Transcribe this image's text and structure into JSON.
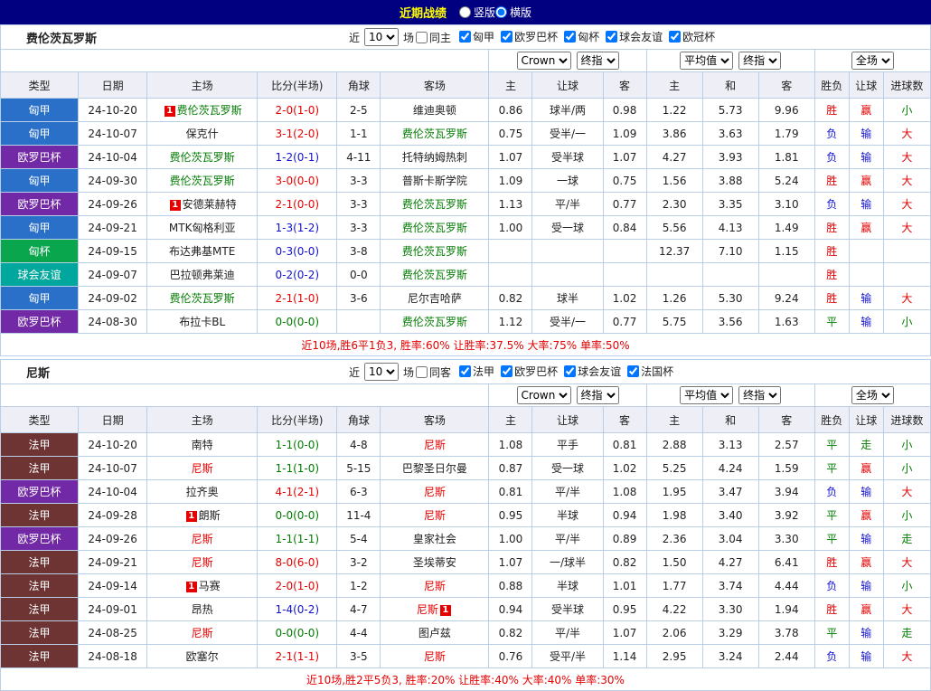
{
  "palette": {
    "red": "#e60000",
    "blue": "#1010d0",
    "green": "#007b00",
    "black": "#222222",
    "topbar_bg": "#000080",
    "title_color": "#ffff00",
    "border": "#b9cfe7",
    "header_bg": "#eeeef6",
    "league": {
      "匈甲": "#2a70c8",
      "欧罗巴杯": "#7229a5",
      "匈杯": "#0aa64e",
      "球会友谊": "#00a79c",
      "法甲": "#6e3434"
    }
  },
  "topbar": {
    "title": "近期战绩",
    "layout_options": [
      {
        "label": "竖版",
        "selected": false
      },
      {
        "label": "横版",
        "selected": true
      }
    ]
  },
  "table_columns": [
    "类型",
    "日期",
    "主场",
    "比分(半场)",
    "角球",
    "客场",
    "主",
    "让球",
    "客",
    "主",
    "和",
    "客",
    "胜负",
    "让球",
    "进球数"
  ],
  "sections": [
    {
      "team": "费伦茨瓦罗斯",
      "filter": {
        "prefix": "近",
        "count": "10",
        "suffix": "场",
        "same": {
          "label": "同主",
          "checked": false
        },
        "leagues": [
          {
            "label": "匈甲",
            "checked": true
          },
          {
            "label": "欧罗巴杯",
            "checked": true
          },
          {
            "label": "匈杯",
            "checked": true
          },
          {
            "label": "球会友谊",
            "checked": true
          },
          {
            "label": "欧冠杯",
            "checked": true
          }
        ]
      },
      "selects": {
        "odds_source": "Crown",
        "odds_kind": "终指",
        "euro_source": "平均值",
        "euro_kind": "终指",
        "scope": "全场"
      },
      "rows": [
        {
          "league": "匈甲",
          "date": "24-10-20",
          "home": "费伦茨瓦罗斯",
          "home_color": "green",
          "home_card": "1",
          "score": "2-0(1-0)",
          "score_color": "red",
          "corners": "2-5",
          "away": "维迪奥顿",
          "away_color": "",
          "away_card": "",
          "ah": [
            "0.86",
            "球半/两",
            "0.98"
          ],
          "eu": [
            "1.22",
            "5.73",
            "9.96"
          ],
          "res": [
            "胜",
            "赢",
            "小"
          ],
          "res_colors": [
            "red",
            "red",
            "green"
          ]
        },
        {
          "league": "匈甲",
          "date": "24-10-07",
          "home": "保克什",
          "home_color": "",
          "home_card": "",
          "score": "3-1(2-0)",
          "score_color": "red",
          "corners": "1-1",
          "away": "费伦茨瓦罗斯",
          "away_color": "green",
          "away_card": "",
          "ah": [
            "0.75",
            "受半/一",
            "1.09"
          ],
          "eu": [
            "3.86",
            "3.63",
            "1.79"
          ],
          "res": [
            "负",
            "输",
            "大"
          ],
          "res_colors": [
            "blue",
            "blue",
            "red"
          ]
        },
        {
          "league": "欧罗巴杯",
          "date": "24-10-04",
          "home": "费伦茨瓦罗斯",
          "home_color": "green",
          "home_card": "",
          "score": "1-2(0-1)",
          "score_color": "blue",
          "corners": "4-11",
          "away": "托特纳姆热刺",
          "away_color": "",
          "away_card": "",
          "ah": [
            "1.07",
            "受半球",
            "1.07"
          ],
          "eu": [
            "4.27",
            "3.93",
            "1.81"
          ],
          "res": [
            "负",
            "输",
            "大"
          ],
          "res_colors": [
            "blue",
            "blue",
            "red"
          ]
        },
        {
          "league": "匈甲",
          "date": "24-09-30",
          "home": "费伦茨瓦罗斯",
          "home_color": "green",
          "home_card": "",
          "score": "3-0(0-0)",
          "score_color": "red",
          "corners": "3-3",
          "away": "普斯卡斯学院",
          "away_color": "",
          "away_card": "",
          "ah": [
            "1.09",
            "一球",
            "0.75"
          ],
          "eu": [
            "1.56",
            "3.88",
            "5.24"
          ],
          "res": [
            "胜",
            "赢",
            "大"
          ],
          "res_colors": [
            "red",
            "red",
            "red"
          ]
        },
        {
          "league": "欧罗巴杯",
          "date": "24-09-26",
          "home": "安德莱赫特",
          "home_color": "",
          "home_card": "1",
          "score": "2-1(0-0)",
          "score_color": "red",
          "corners": "3-3",
          "away": "费伦茨瓦罗斯",
          "away_color": "green",
          "away_card": "",
          "ah": [
            "1.13",
            "平/半",
            "0.77"
          ],
          "eu": [
            "2.30",
            "3.35",
            "3.10"
          ],
          "res": [
            "负",
            "输",
            "大"
          ],
          "res_colors": [
            "blue",
            "blue",
            "red"
          ]
        },
        {
          "league": "匈甲",
          "date": "24-09-21",
          "home": "MTK匈格利亚",
          "home_color": "",
          "home_card": "",
          "score": "1-3(1-2)",
          "score_color": "blue",
          "corners": "3-3",
          "away": "费伦茨瓦罗斯",
          "away_color": "green",
          "away_card": "",
          "ah": [
            "1.00",
            "受一球",
            "0.84"
          ],
          "eu": [
            "5.56",
            "4.13",
            "1.49"
          ],
          "res": [
            "胜",
            "赢",
            "大"
          ],
          "res_colors": [
            "red",
            "red",
            "red"
          ]
        },
        {
          "league": "匈杯",
          "date": "24-09-15",
          "home": "布达弗基MTE",
          "home_color": "",
          "home_card": "",
          "score": "0-3(0-0)",
          "score_color": "blue",
          "corners": "3-8",
          "away": "费伦茨瓦罗斯",
          "away_color": "green",
          "away_card": "",
          "ah": [
            "",
            "",
            ""
          ],
          "eu": [
            "12.37",
            "7.10",
            "1.15"
          ],
          "res": [
            "胜",
            "",
            ""
          ],
          "res_colors": [
            "red",
            "",
            ""
          ]
        },
        {
          "league": "球会友谊",
          "date": "24-09-07",
          "home": "巴拉顿弗莱迪",
          "home_color": "",
          "home_card": "",
          "score": "0-2(0-2)",
          "score_color": "blue",
          "corners": "0-0",
          "away": "费伦茨瓦罗斯",
          "away_color": "green",
          "away_card": "",
          "ah": [
            "",
            "",
            ""
          ],
          "eu": [
            "",
            "",
            ""
          ],
          "res": [
            "胜",
            "",
            ""
          ],
          "res_colors": [
            "red",
            "",
            ""
          ]
        },
        {
          "league": "匈甲",
          "date": "24-09-02",
          "home": "费伦茨瓦罗斯",
          "home_color": "green",
          "home_card": "",
          "score": "2-1(1-0)",
          "score_color": "red",
          "corners": "3-6",
          "away": "尼尔吉哈萨",
          "away_color": "",
          "away_card": "",
          "ah": [
            "0.82",
            "球半",
            "1.02"
          ],
          "eu": [
            "1.26",
            "5.30",
            "9.24"
          ],
          "res": [
            "胜",
            "输",
            "大"
          ],
          "res_colors": [
            "red",
            "blue",
            "red"
          ]
        },
        {
          "league": "欧罗巴杯",
          "date": "24-08-30",
          "home": "布拉卡BL",
          "home_color": "",
          "home_card": "",
          "score": "0-0(0-0)",
          "score_color": "green",
          "corners": "",
          "away": "费伦茨瓦罗斯",
          "away_color": "green",
          "away_card": "",
          "ah": [
            "1.12",
            "受半/一",
            "0.77"
          ],
          "eu": [
            "5.75",
            "3.56",
            "1.63"
          ],
          "res": [
            "平",
            "输",
            "小"
          ],
          "res_colors": [
            "green",
            "blue",
            "green"
          ]
        }
      ],
      "summary": "近10场,胜6平1负3, 胜率:60%  让胜率:37.5%  大率:75%  单率:50%"
    },
    {
      "team": "尼斯",
      "filter": {
        "prefix": "近",
        "count": "10",
        "suffix": "场",
        "same": {
          "label": "同客",
          "checked": false
        },
        "leagues": [
          {
            "label": "法甲",
            "checked": true
          },
          {
            "label": "欧罗巴杯",
            "checked": true
          },
          {
            "label": "球会友谊",
            "checked": true
          },
          {
            "label": "法国杯",
            "checked": true
          }
        ]
      },
      "selects": {
        "odds_source": "Crown",
        "odds_kind": "终指",
        "euro_source": "平均值",
        "euro_kind": "终指",
        "scope": "全场"
      },
      "rows": [
        {
          "league": "法甲",
          "date": "24-10-20",
          "home": "南特",
          "home_color": "",
          "home_card": "",
          "score": "1-1(0-0)",
          "score_color": "green",
          "corners": "4-8",
          "away": "尼斯",
          "away_color": "red",
          "away_card": "",
          "ah": [
            "1.08",
            "平手",
            "0.81"
          ],
          "eu": [
            "2.88",
            "3.13",
            "2.57"
          ],
          "res": [
            "平",
            "走",
            "小"
          ],
          "res_colors": [
            "green",
            "green",
            "green"
          ]
        },
        {
          "league": "法甲",
          "date": "24-10-07",
          "home": "尼斯",
          "home_color": "red",
          "home_card": "",
          "score": "1-1(1-0)",
          "score_color": "green",
          "corners": "5-15",
          "away": "巴黎圣日尔曼",
          "away_color": "",
          "away_card": "",
          "ah": [
            "0.87",
            "受一球",
            "1.02"
          ],
          "eu": [
            "5.25",
            "4.24",
            "1.59"
          ],
          "res": [
            "平",
            "赢",
            "小"
          ],
          "res_colors": [
            "green",
            "red",
            "green"
          ]
        },
        {
          "league": "欧罗巴杯",
          "date": "24-10-04",
          "home": "拉齐奥",
          "home_color": "",
          "home_card": "",
          "score": "4-1(2-1)",
          "score_color": "red",
          "corners": "6-3",
          "away": "尼斯",
          "away_color": "red",
          "away_card": "",
          "ah": [
            "0.81",
            "平/半",
            "1.08"
          ],
          "eu": [
            "1.95",
            "3.47",
            "3.94"
          ],
          "res": [
            "负",
            "输",
            "大"
          ],
          "res_colors": [
            "blue",
            "blue",
            "red"
          ]
        },
        {
          "league": "法甲",
          "date": "24-09-28",
          "home": "朗斯",
          "home_color": "",
          "home_card": "1",
          "score": "0-0(0-0)",
          "score_color": "green",
          "corners": "11-4",
          "away": "尼斯",
          "away_color": "red",
          "away_card": "",
          "ah": [
            "0.95",
            "半球",
            "0.94"
          ],
          "eu": [
            "1.98",
            "3.40",
            "3.92"
          ],
          "res": [
            "平",
            "赢",
            "小"
          ],
          "res_colors": [
            "green",
            "red",
            "green"
          ]
        },
        {
          "league": "欧罗巴杯",
          "date": "24-09-26",
          "home": "尼斯",
          "home_color": "red",
          "home_card": "",
          "score": "1-1(1-1)",
          "score_color": "green",
          "corners": "5-4",
          "away": "皇家社会",
          "away_color": "",
          "away_card": "",
          "ah": [
            "1.00",
            "平/半",
            "0.89"
          ],
          "eu": [
            "2.36",
            "3.04",
            "3.30"
          ],
          "res": [
            "平",
            "输",
            "走"
          ],
          "res_colors": [
            "green",
            "blue",
            "green"
          ]
        },
        {
          "league": "法甲",
          "date": "24-09-21",
          "home": "尼斯",
          "home_color": "red",
          "home_card": "",
          "score": "8-0(6-0)",
          "score_color": "red",
          "corners": "3-2",
          "away": "圣埃蒂安",
          "away_color": "",
          "away_card": "",
          "ah": [
            "1.07",
            "一/球半",
            "0.82"
          ],
          "eu": [
            "1.50",
            "4.27",
            "6.41"
          ],
          "res": [
            "胜",
            "赢",
            "大"
          ],
          "res_colors": [
            "red",
            "red",
            "red"
          ]
        },
        {
          "league": "法甲",
          "date": "24-09-14",
          "home": "马赛",
          "home_color": "",
          "home_card": "1",
          "score": "2-0(1-0)",
          "score_color": "red",
          "corners": "1-2",
          "away": "尼斯",
          "away_color": "red",
          "away_card": "",
          "ah": [
            "0.88",
            "半球",
            "1.01"
          ],
          "eu": [
            "1.77",
            "3.74",
            "4.44"
          ],
          "res": [
            "负",
            "输",
            "小"
          ],
          "res_colors": [
            "blue",
            "blue",
            "green"
          ]
        },
        {
          "league": "法甲",
          "date": "24-09-01",
          "home": "昂热",
          "home_color": "",
          "home_card": "",
          "score": "1-4(0-2)",
          "score_color": "blue",
          "corners": "4-7",
          "away": "尼斯",
          "away_color": "red",
          "away_card": "1",
          "ah": [
            "0.94",
            "受半球",
            "0.95"
          ],
          "eu": [
            "4.22",
            "3.30",
            "1.94"
          ],
          "res": [
            "胜",
            "赢",
            "大"
          ],
          "res_colors": [
            "red",
            "red",
            "red"
          ]
        },
        {
          "league": "法甲",
          "date": "24-08-25",
          "home": "尼斯",
          "home_color": "red",
          "home_card": "",
          "score": "0-0(0-0)",
          "score_color": "green",
          "corners": "4-4",
          "away": "图卢兹",
          "away_color": "",
          "away_card": "",
          "ah": [
            "0.82",
            "平/半",
            "1.07"
          ],
          "eu": [
            "2.06",
            "3.29",
            "3.78"
          ],
          "res": [
            "平",
            "输",
            "走"
          ],
          "res_colors": [
            "green",
            "blue",
            "green"
          ]
        },
        {
          "league": "法甲",
          "date": "24-08-18",
          "home": "欧塞尔",
          "home_color": "",
          "home_card": "",
          "score": "2-1(1-1)",
          "score_color": "red",
          "corners": "3-5",
          "away": "尼斯",
          "away_color": "red",
          "away_card": "",
          "ah": [
            "0.76",
            "受平/半",
            "1.14"
          ],
          "eu": [
            "2.95",
            "3.24",
            "2.44"
          ],
          "res": [
            "负",
            "输",
            "大"
          ],
          "res_colors": [
            "blue",
            "blue",
            "red"
          ]
        }
      ],
      "summary": "近10场,胜2平5负3, 胜率:20%  让胜率:40%  大率:40%  单率:30%"
    }
  ]
}
